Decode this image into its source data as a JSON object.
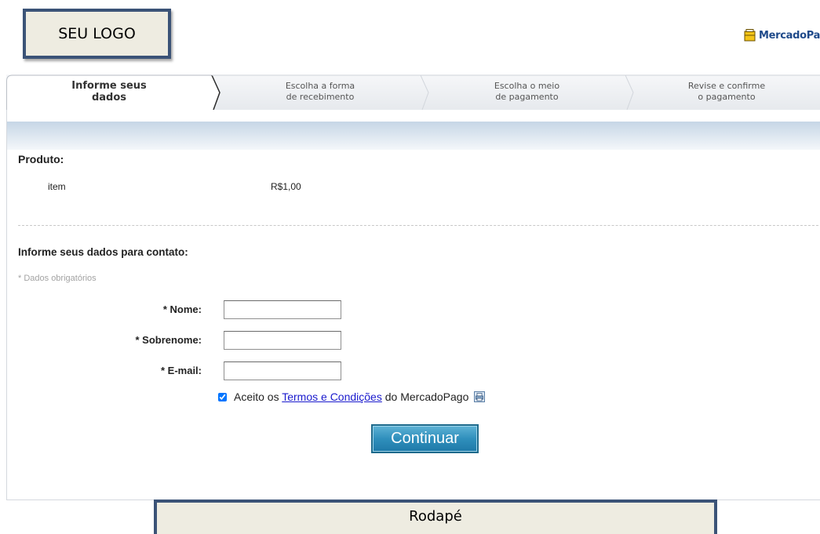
{
  "header": {
    "logo_text": "SEU LOGO",
    "brand": "MercadoPago",
    "brand_icon": "wallet-icon"
  },
  "steps": [
    {
      "line1": "Informe seus",
      "line2": "dados",
      "active": true
    },
    {
      "line1": "Escolha a forma",
      "line2": "de recebimento",
      "active": false
    },
    {
      "line1": "Escolha o meio",
      "line2": "de pagamento",
      "active": false
    },
    {
      "line1": "Revise e confirme",
      "line2": "o pagamento",
      "active": false
    }
  ],
  "product": {
    "heading": "Produto:",
    "item_name": "item",
    "item_price": "R$1,00"
  },
  "contact": {
    "heading": "Informe seus dados para contato:",
    "required_note": "* Dados obrigatórios",
    "fields": {
      "nome_label": "* Nome:",
      "nome_value": "",
      "sobrenome_label": "* Sobrenome:",
      "sobrenome_value": "",
      "email_label": "* E-mail:",
      "email_value": ""
    },
    "terms": {
      "checked": true,
      "prefix": "Aceito os",
      "link": "Termos e Condições",
      "suffix": "do MercadoPago",
      "print_icon": "print-icon"
    },
    "continue_label": "Continuar"
  },
  "footer": {
    "text": "Rodapé"
  },
  "colors": {
    "box_border": "#3b5377",
    "box_fill": "#eeece1",
    "brand_text": "#1f4a8a",
    "link": "#1a1acd",
    "button": "#2f8fbc"
  }
}
